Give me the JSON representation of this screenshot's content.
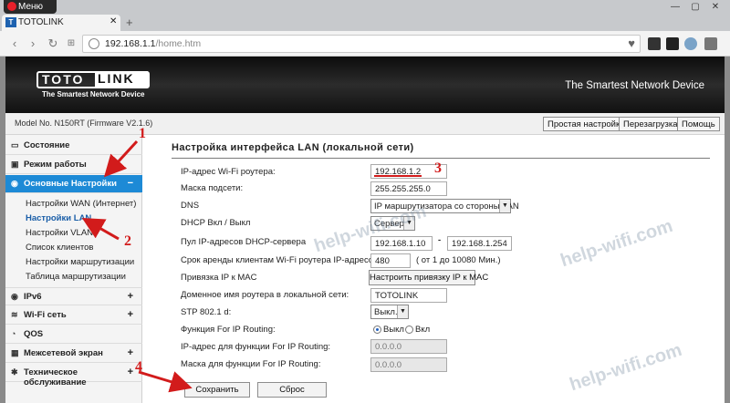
{
  "browser": {
    "menu_label": "Меню",
    "tab_title": "TOTOLINK",
    "tab_favicon": "T",
    "url_host": "192.168.1.1",
    "url_path": "/home.htm"
  },
  "header": {
    "logo_left": "TOTO",
    "logo_right": "LINK",
    "logo_tagline": "The Smartest Network Device",
    "banner_tagline": "The Smartest Network Device",
    "model": "Model No. N150RT (Firmware V2.1.6)",
    "buttons": {
      "easy_setup": "Простая настройка",
      "reboot": "Перезагрузка",
      "help": "Помощь"
    }
  },
  "sidebar": {
    "items": [
      {
        "label": "Состояние",
        "icon": "monitor-icon",
        "toggle": ""
      },
      {
        "label": "Режим работы",
        "icon": "settings-icon",
        "toggle": ""
      },
      {
        "label": "Основные Настройки",
        "icon": "globe-icon",
        "toggle": "−"
      },
      {
        "label": "IPv6",
        "icon": "globe-icon",
        "toggle": "+"
      },
      {
        "label": "Wi-Fi сеть",
        "icon": "wifi-icon",
        "toggle": "+"
      },
      {
        "label": "QOS",
        "icon": "gauge-icon",
        "toggle": ""
      },
      {
        "label": "Межсетевой экран",
        "icon": "firewall-icon",
        "toggle": "+"
      },
      {
        "label": "Техническое обслуживание",
        "icon": "wrench-icon",
        "toggle": "+"
      }
    ],
    "subitems": [
      "Настройки WAN (Интернет)",
      "Настройки LAN",
      "Настройки VLAN",
      "Список клиентов",
      "Настройки маршрутизации",
      "Таблица маршрутизации"
    ]
  },
  "form": {
    "title": "Настройка интерфейса LAN (локальной сети)",
    "ip_label": "IP-адрес Wi-Fi роутера:",
    "ip_value": "192.168.1.2",
    "mask_label": "Маска подсети:",
    "mask_value": "255.255.255.0",
    "dns_label": "DNS",
    "dns_value": "IP маршрутизатора со стороны LAN",
    "dhcp_label": "DHCP Вкл / Выкл",
    "dhcp_value": "Сервер",
    "pool_label": "Пул IP-адресов DHCP-сервера",
    "pool_start": "192.168.1.10",
    "pool_dash": "-",
    "pool_end": "192.168.1.254",
    "lease_label": "Срок аренды клиентам Wi-Fi роутера IP-адресов",
    "lease_value": "480",
    "lease_hint": "( от 1 до 10080 Мин.)",
    "mac_label": "Привязка IP к MAC",
    "mac_button": "Настроить привязку IP к MAC",
    "domain_label": "Доменное имя роутера в локальной сети:",
    "domain_value": "TOTOLINK",
    "stp_label": "STP 802.1 d:",
    "stp_value": "Выкл.",
    "forip_label": "Функция For IP Routing:",
    "forip_off": "Выкл",
    "forip_on": "Вкл",
    "forip_ip_label": "IP-адрес для функции For IP Routing:",
    "forip_ip_value": "0.0.0.0",
    "forip_mask_label": "Маска для функции For IP Routing:",
    "forip_mask_value": "0.0.0.0",
    "save_button": "Сохранить",
    "reset_button": "Сброс"
  },
  "annotations": {
    "n1": "1",
    "n2": "2",
    "n3": "3",
    "n4": "4",
    "watermark": "help-wifi.com",
    "color": "#d21b1b"
  }
}
